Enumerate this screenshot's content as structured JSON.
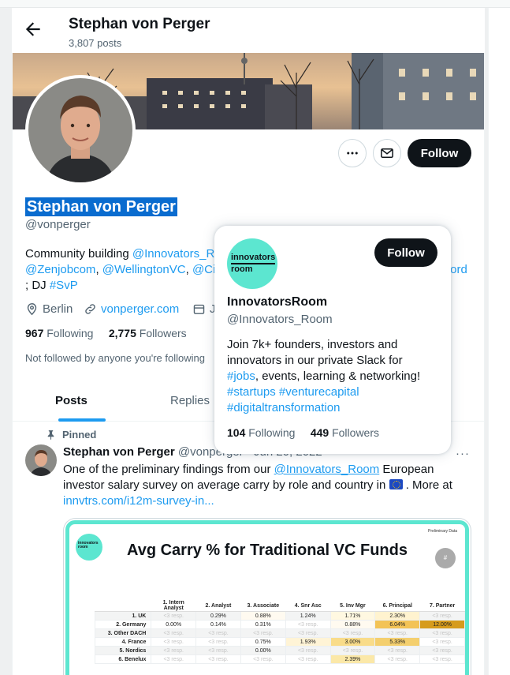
{
  "header": {
    "name": "Stephan von Perger",
    "posts": "3,807 posts"
  },
  "profile": {
    "name": "Stephan von Perger",
    "handle": "@vonperger",
    "bio_lines": [
      [
        "Community building ",
        "@Innovators_R"
      ],
      [
        "@Zenjobcom",
        ", ",
        "@WellingtonVC",
        ", ",
        "@Cit",
        "ford"
      ],
      [
        "; DJ ",
        "#SvP"
      ]
    ],
    "location": "Berlin",
    "website": "vonperger.com",
    "joined_partial": "J",
    "following_count": "967",
    "following_label": "Following",
    "followers_count": "2,775",
    "followers_label": "Followers",
    "not_followed": "Not followed by anyone you're following",
    "follow_label": "Follow"
  },
  "tabs": [
    "Posts",
    "Replies"
  ],
  "hover_card": {
    "logo_text_1": "innovators",
    "logo_text_2": "room",
    "follow_label": "Follow",
    "name": "InnovatorsRoom",
    "handle": "@Innovators_Room",
    "bio_1": "Join 7k+ founders, investors and",
    "bio_2": "innovators in our private Slack for",
    "bio_3a": "#jobs",
    "bio_3b": ", events, learning & networking!",
    "bio_4": "#startups #venturecapital",
    "bio_5": "#digitaltransformation",
    "following_count": "104",
    "following_label": "Following",
    "followers_count": "449",
    "followers_label": "Followers"
  },
  "post": {
    "pinned_label": "Pinned",
    "author": "Stephan von Perger",
    "handle_date": "@vonperger · Jun 20, 2022",
    "more": "···",
    "text_1a": "One of the preliminary findings from our ",
    "text_1b": "@Innovators_Room",
    "text_1c": " European",
    "text_2a": "investor salary survey on average carry by role and country in ",
    "text_2b": " . More at",
    "text_3": "innvtrs.com/i12m-survey-in..."
  },
  "chart_image": {
    "logo": "innovators room",
    "prelim": "Preliminary Data",
    "hash": "#",
    "title": "Avg Carry % for Traditional VC Funds",
    "columns": [
      "",
      "1. Intern Analyst",
      "2. Analyst",
      "3. Associate",
      "4. Snr Asc",
      "5. Inv Mgr",
      "6. Principal",
      "7. Partner"
    ],
    "rows": [
      [
        "1. UK",
        "<3 resp.",
        "0.29%",
        "0.88%",
        "1.24%",
        "1.71%",
        "2.30%",
        "<3 resp."
      ],
      [
        "2. Germany",
        "0.00%",
        "0.14%",
        "0.31%",
        "<3 resp.",
        "0.88%",
        "6.04%",
        "12.00%"
      ],
      [
        "3. Other DACH",
        "<3 resp.",
        "<3 resp.",
        "<3 resp.",
        "<3 resp.",
        "<3 resp.",
        "<3 resp.",
        "<3 resp."
      ],
      [
        "4. France",
        "<3 resp.",
        "<3 resp.",
        "0.75%",
        "1.93%",
        "3.00%",
        "5.33%",
        "<3 resp."
      ],
      [
        "5. Nordics",
        "<3 resp.",
        "<3 resp.",
        "0.00%",
        "<3 resp.",
        "<3 resp.",
        "<3 resp.",
        "<3 resp."
      ],
      [
        "6. Benelux",
        "<3 resp.",
        "<3 resp.",
        "<3 resp.",
        "<3 resp.",
        "2.39%",
        "<3 resp.",
        "<3 resp."
      ]
    ],
    "highlight": {
      "1.71%": "#fff8e1",
      "2.30%": "#fff3cf",
      "6.04%": "#f3c356",
      "12.00%": "#d69b1c",
      "3.00%": "#f9dc8a",
      "5.33%": "#f4cf6e",
      "2.39%": "#fbe8a8",
      "1.93%": "#fff4d6",
      "0.88%": "#fffaf0"
    },
    "colors": {
      "accent": "#5ce6d0"
    }
  },
  "colors": {
    "link": "#1d9bf0",
    "text": "#0f1419",
    "muted": "#536471",
    "selection": "#0a6ccf"
  }
}
